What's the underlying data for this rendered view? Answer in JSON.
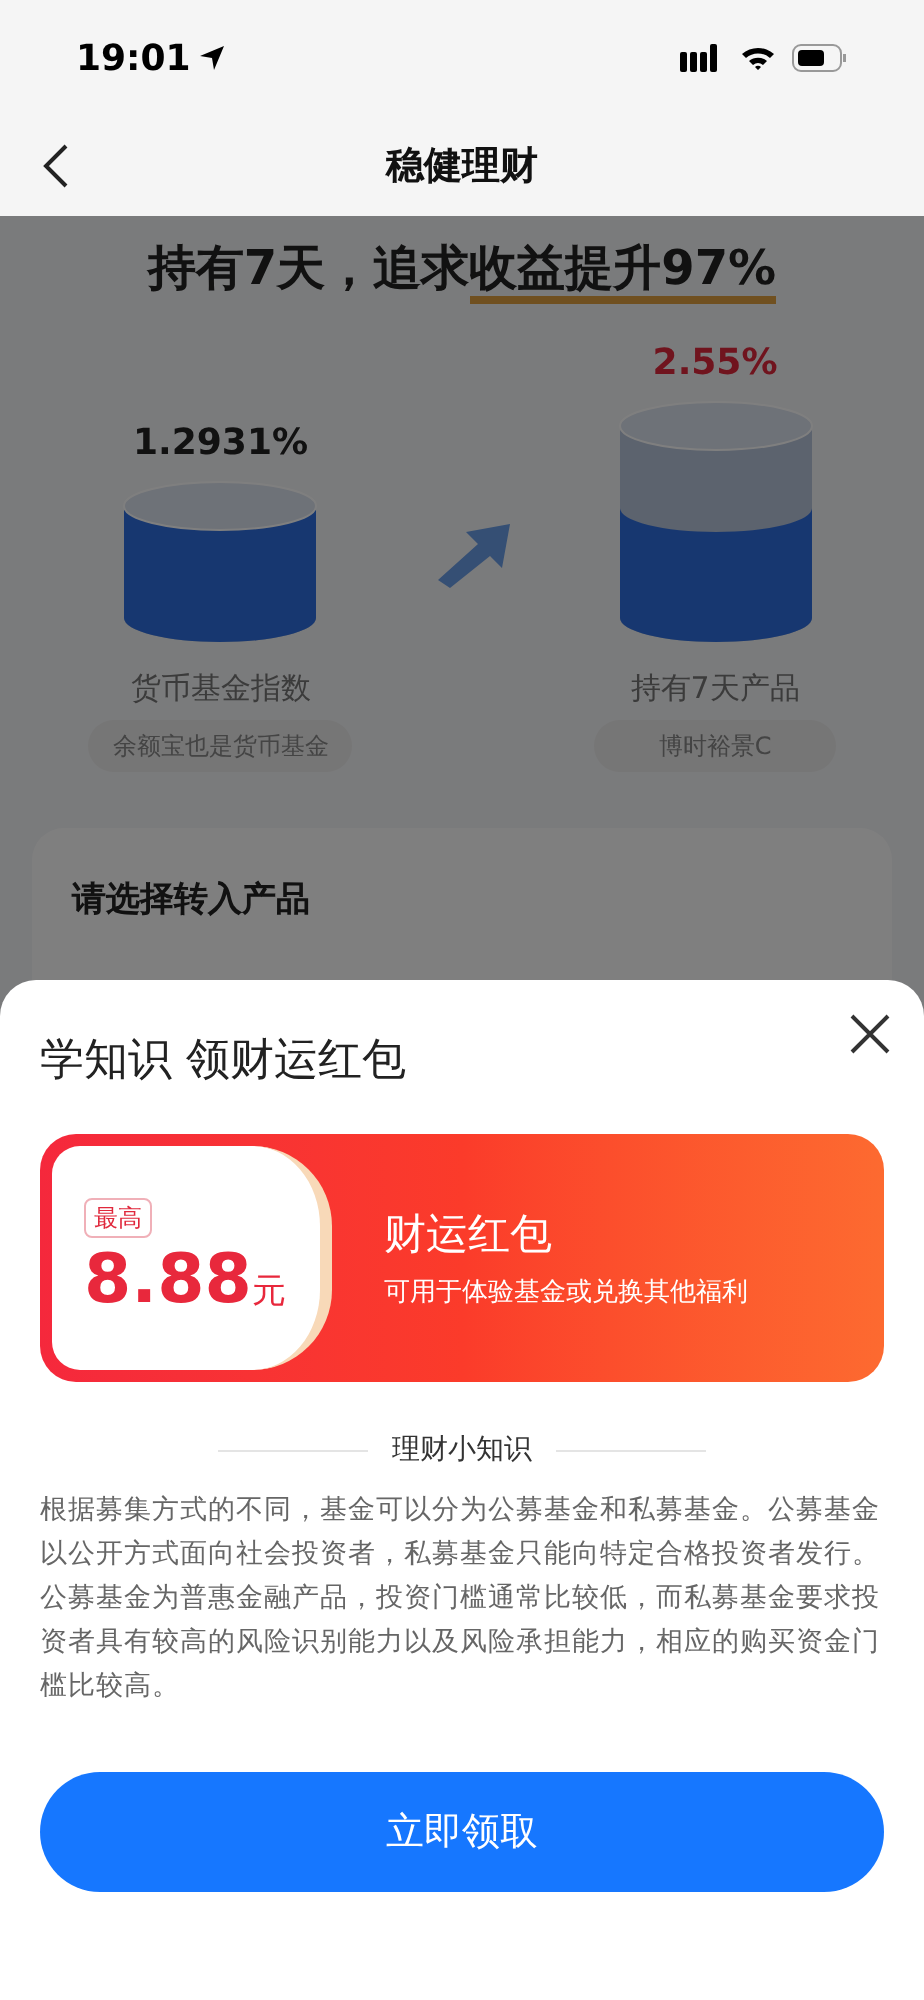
{
  "status_bar": {
    "time": "19:01"
  },
  "nav": {
    "title": "稳健理财"
  },
  "page": {
    "headline_plain": "持有7天，追求",
    "headline_highlight": "收益提升97%",
    "left": {
      "rate": "1.2931%",
      "label": "货币基金指数",
      "tag": "余额宝也是货币基金"
    },
    "right": {
      "rate": "2.55%",
      "label": "持有7天产品",
      "tag": "博时裕景C"
    },
    "section_title": "请选择转入产品"
  },
  "sheet": {
    "title": "学知识 领财运红包",
    "coupon": {
      "badge": "最高",
      "amount": "8.88",
      "unit": "元",
      "name": "财运红包",
      "description": "可用于体验基金或兑换其他福利"
    },
    "tips_title": "理财小知识",
    "tips_text": "根据募集方式的不同，基金可以分为公募基金和私募基金。公募基金以公开方式面向社会投资者，私募基金只能向特定合格投资者发行。公募基金为普惠金融产品，投资门槛通常比较低，而私募基金要求投资者具有较高的风险识别能力以及风险承担能力，相应的购买资金门槛比较高。",
    "button": "立即领取"
  }
}
